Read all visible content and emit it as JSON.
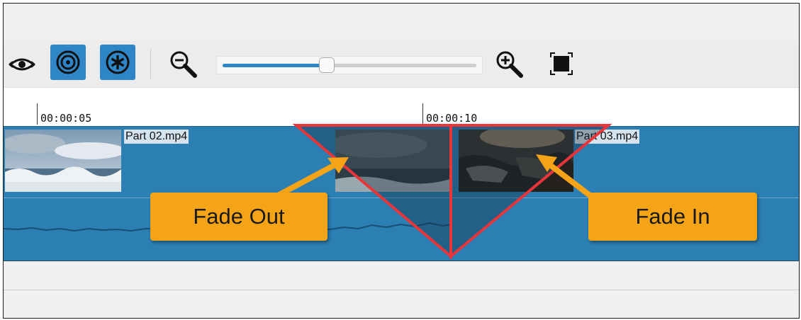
{
  "timeline": {
    "ruler": {
      "marks": [
        "00:00:05",
        "00:00:10"
      ]
    },
    "clips": [
      {
        "name": "Part 02.mp4"
      },
      {
        "name": "Part 03.mp4"
      }
    ]
  },
  "toolbar": {
    "zoom_level_fraction": 0.41
  },
  "annotations": {
    "fade_out": "Fade Out",
    "fade_in": "Fade In"
  },
  "colors": {
    "accent": "#2f86c7",
    "track": "#2b7fb3",
    "callout": "#f5a418",
    "transition_outline": "#e8353a"
  },
  "icons": [
    "eye-icon",
    "snap-target-icon",
    "ripple-asterisk-icon",
    "zoom-out-icon",
    "zoom-in-icon",
    "zoom-fit-icon"
  ]
}
